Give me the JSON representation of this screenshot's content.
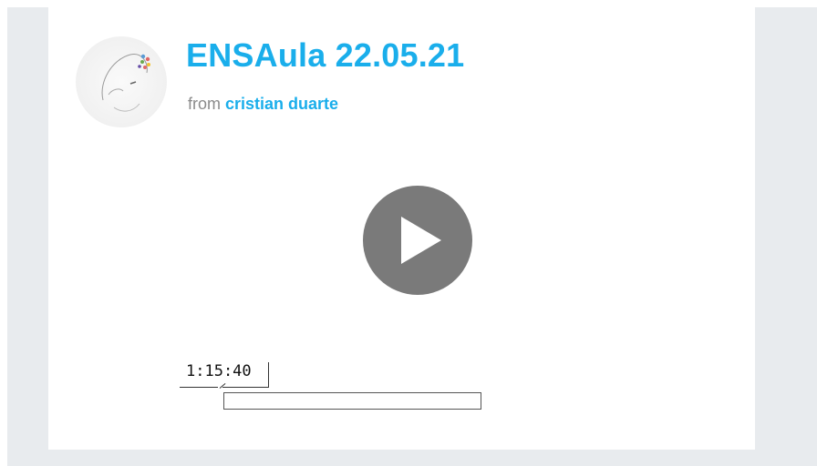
{
  "video": {
    "title": "ENSAula 22.05.21",
    "byline_prefix": "from",
    "author": "cristian duarte",
    "duration": "1:15:40",
    "progress_fraction": 0
  },
  "colors": {
    "accent": "#1aaeeb",
    "muted_text": "#8b8b8b",
    "play_button": "#7a7a7a",
    "frame_background": "#e8ebee"
  },
  "icons": {
    "play": "play-icon"
  }
}
